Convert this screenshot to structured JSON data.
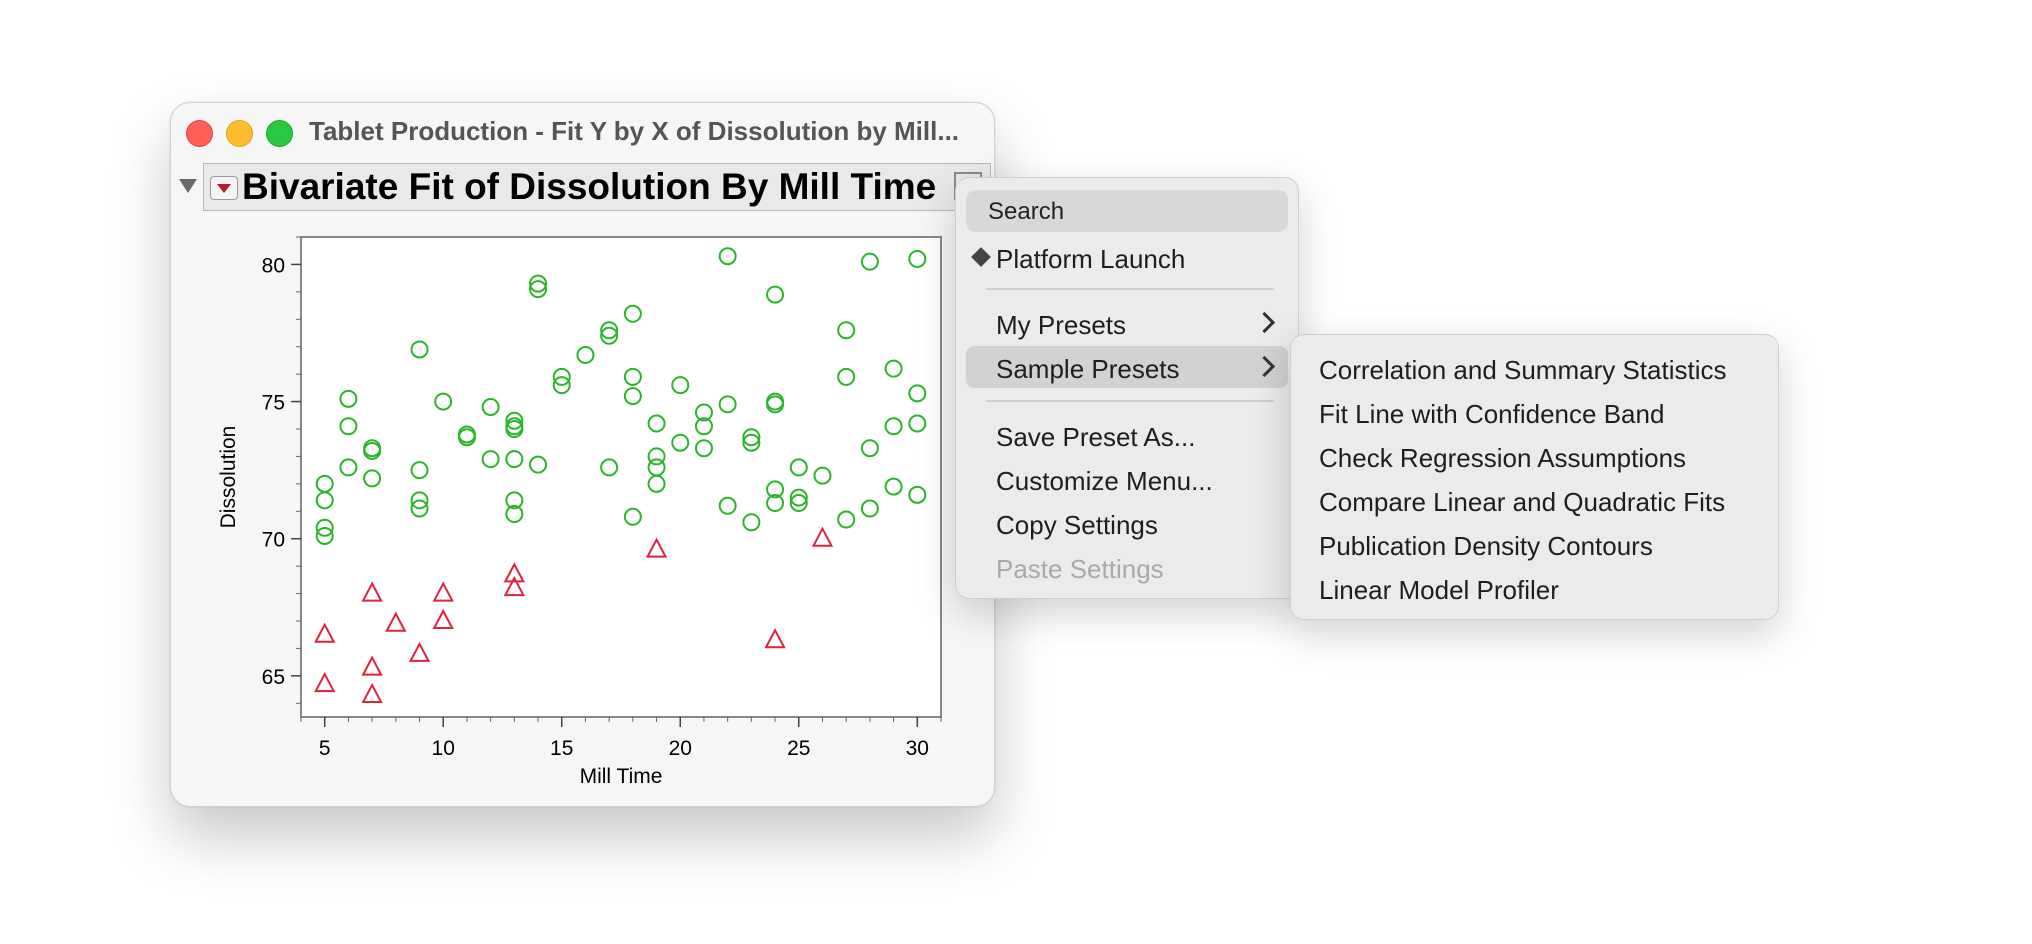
{
  "window": {
    "title": "Tablet Production - Fit Y by X of Dissolution by Mill...",
    "report_title": "Bivariate Fit of Dissolution By Mill Time"
  },
  "chart_data": {
    "type": "scatter",
    "xlabel": "Mill Time",
    "ylabel": "Dissolution",
    "xlim": [
      4,
      31
    ],
    "ylim": [
      63.5,
      81
    ],
    "xticks": [
      5,
      10,
      15,
      20,
      25,
      30
    ],
    "yticks": [
      65,
      70,
      75,
      80
    ],
    "grid": false,
    "colors": {
      "circle": "#2ab52a",
      "triangle": "#e0223a"
    },
    "series": [
      {
        "marker": "circle",
        "points": [
          [
            5,
            72.0
          ],
          [
            5,
            71.4
          ],
          [
            5,
            70.4
          ],
          [
            5,
            70.1
          ],
          [
            6,
            75.1
          ],
          [
            6,
            74.1
          ],
          [
            6,
            72.6
          ],
          [
            7,
            73.3
          ],
          [
            7,
            73.2
          ],
          [
            7,
            72.2
          ],
          [
            9,
            76.9
          ],
          [
            9,
            72.5
          ],
          [
            9,
            71.4
          ],
          [
            9,
            71.1
          ],
          [
            10,
            75.0
          ],
          [
            11,
            73.8
          ],
          [
            11,
            73.7
          ],
          [
            12,
            74.8
          ],
          [
            12,
            72.9
          ],
          [
            13,
            74.3
          ],
          [
            13,
            74.1
          ],
          [
            13,
            74.0
          ],
          [
            13,
            72.9
          ],
          [
            13,
            71.4
          ],
          [
            13,
            70.9
          ],
          [
            14,
            79.3
          ],
          [
            14,
            79.1
          ],
          [
            14,
            72.7
          ],
          [
            15,
            75.9
          ],
          [
            15,
            75.6
          ],
          [
            16,
            76.7
          ],
          [
            17,
            77.6
          ],
          [
            17,
            77.4
          ],
          [
            17,
            72.6
          ],
          [
            18,
            78.2
          ],
          [
            18,
            75.9
          ],
          [
            18,
            75.2
          ],
          [
            18,
            70.8
          ],
          [
            19,
            74.2
          ],
          [
            19,
            73.0
          ],
          [
            19,
            72.6
          ],
          [
            19,
            72.0
          ],
          [
            20,
            75.6
          ],
          [
            20,
            73.5
          ],
          [
            21,
            74.6
          ],
          [
            21,
            74.1
          ],
          [
            21,
            73.3
          ],
          [
            22,
            80.3
          ],
          [
            22,
            74.9
          ],
          [
            22,
            71.2
          ],
          [
            23,
            73.7
          ],
          [
            23,
            73.5
          ],
          [
            23,
            70.6
          ],
          [
            24,
            78.9
          ],
          [
            24,
            75.0
          ],
          [
            24,
            74.9
          ],
          [
            24,
            71.8
          ],
          [
            24,
            71.3
          ],
          [
            25,
            72.6
          ],
          [
            25,
            71.5
          ],
          [
            25,
            71.3
          ],
          [
            26,
            72.3
          ],
          [
            27,
            77.6
          ],
          [
            27,
            75.9
          ],
          [
            27,
            70.7
          ],
          [
            28,
            80.1
          ],
          [
            28,
            73.3
          ],
          [
            28,
            71.1
          ],
          [
            29,
            76.2
          ],
          [
            29,
            74.1
          ],
          [
            29,
            71.9
          ],
          [
            30,
            80.2
          ],
          [
            30,
            75.3
          ],
          [
            30,
            74.2
          ],
          [
            30,
            71.6
          ]
        ]
      },
      {
        "marker": "triangle",
        "points": [
          [
            5,
            66.5
          ],
          [
            5,
            64.7
          ],
          [
            7,
            68.0
          ],
          [
            7,
            65.3
          ],
          [
            7,
            64.3
          ],
          [
            8,
            66.9
          ],
          [
            9,
            65.8
          ],
          [
            10,
            68.0
          ],
          [
            10,
            67.0
          ],
          [
            13,
            68.7
          ],
          [
            13,
            68.2
          ],
          [
            19,
            69.6
          ],
          [
            24,
            66.3
          ],
          [
            26,
            70.0
          ]
        ]
      }
    ]
  },
  "context_menu": {
    "search_placeholder": "Search",
    "items": [
      {
        "label": "Platform Launch"
      },
      {
        "label": "My Presets"
      },
      {
        "label": "Sample Presets"
      },
      {
        "label": "Save Preset As..."
      },
      {
        "label": "Customize Menu..."
      },
      {
        "label": "Copy Settings"
      },
      {
        "label": "Paste Settings"
      }
    ]
  },
  "submenu": {
    "items": [
      {
        "label": "Correlation and Summary Statistics"
      },
      {
        "label": "Fit Line with Confidence Band"
      },
      {
        "label": "Check Regression Assumptions"
      },
      {
        "label": "Compare Linear and Quadratic Fits"
      },
      {
        "label": "Publication Density Contours"
      },
      {
        "label": "Linear Model Profiler"
      }
    ]
  }
}
